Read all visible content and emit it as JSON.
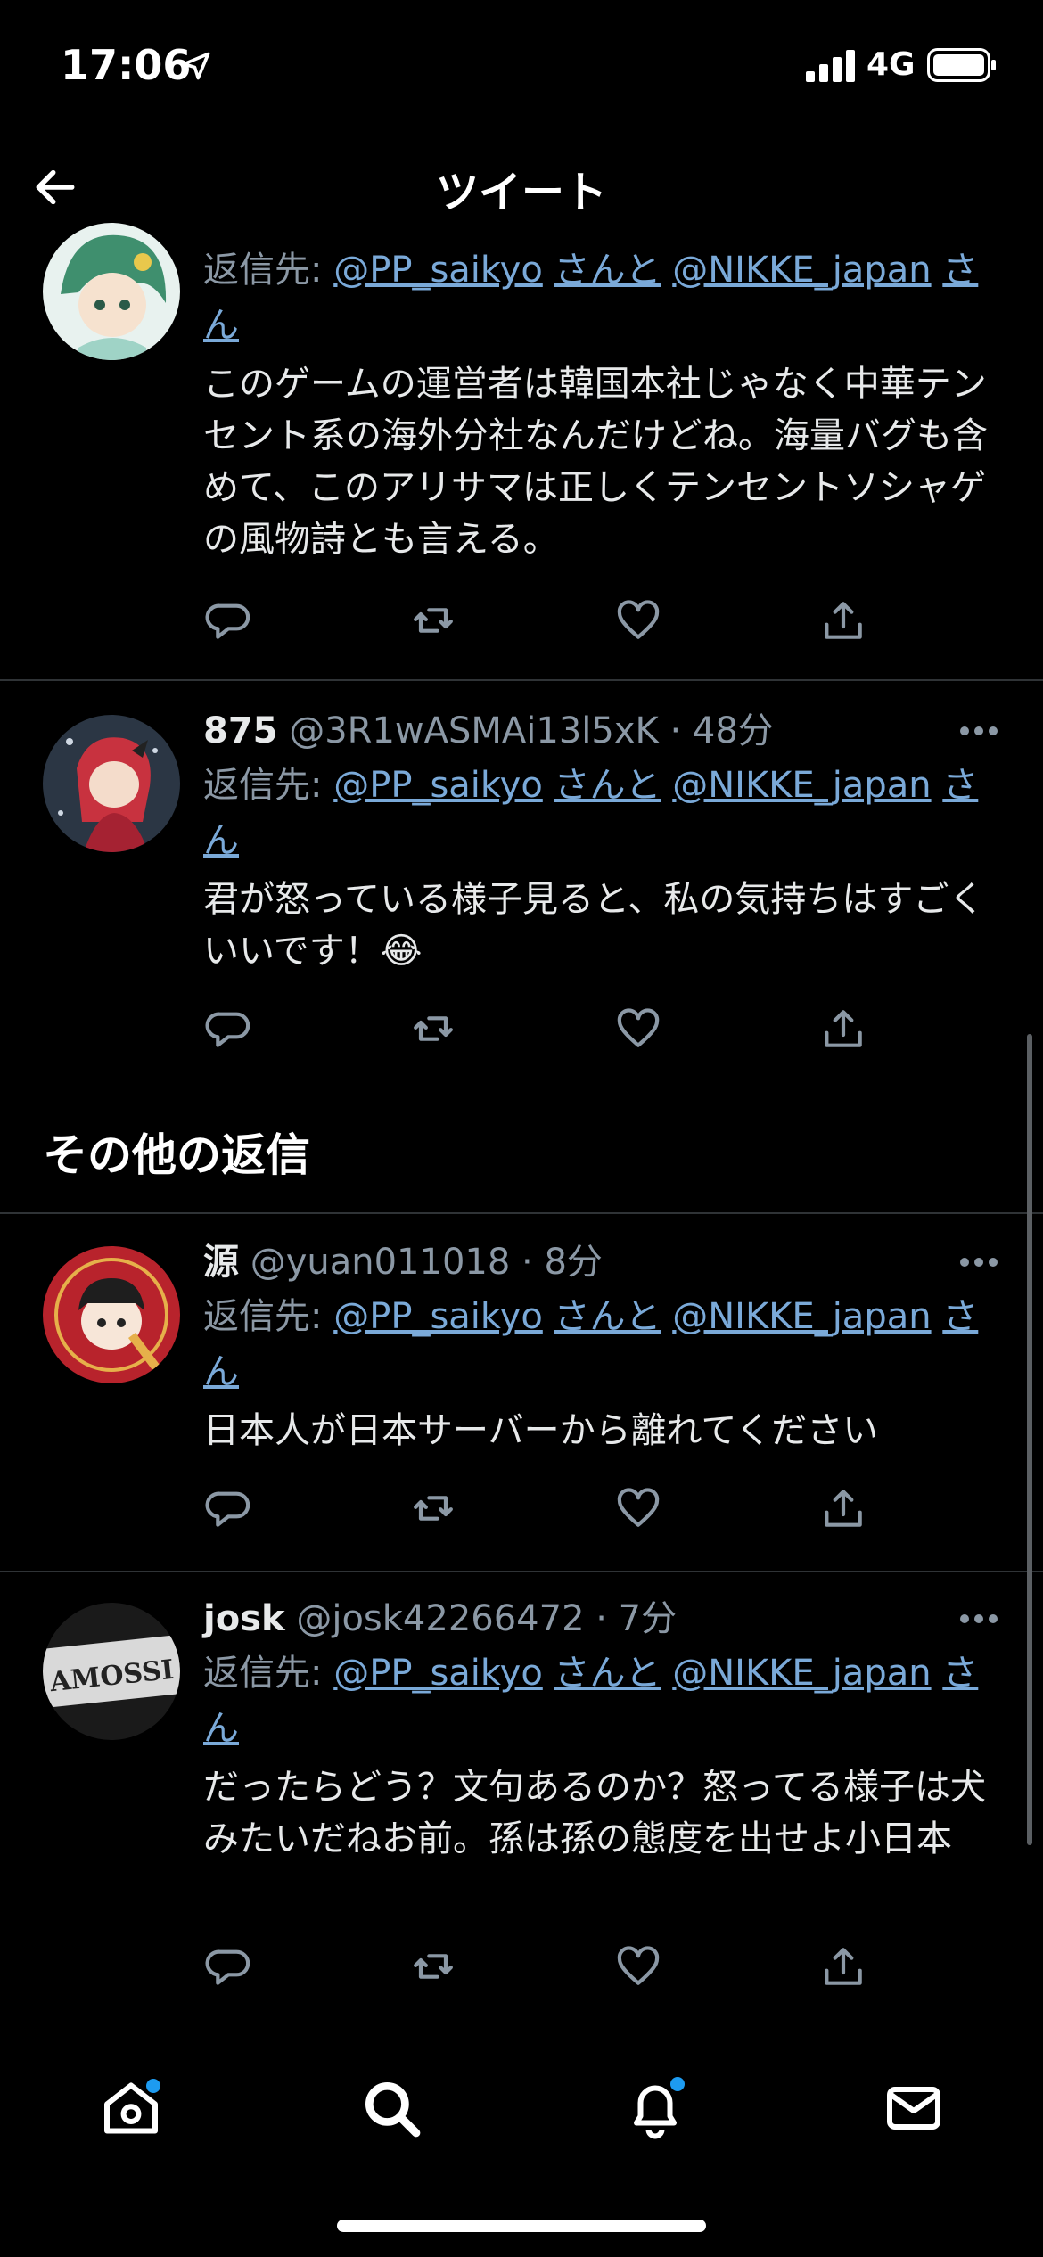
{
  "status_bar": {
    "time": "17:06",
    "network": "4G"
  },
  "header": {
    "title": "ツイート"
  },
  "reply_prefix": "返信先:",
  "tweets": [
    {
      "name": "",
      "handle": "",
      "time": "",
      "reply_to_a": "@PP_saikyo",
      "reply_mid": "さんと",
      "reply_to_b": "@NIKKE_japan",
      "reply_end_1": "さ",
      "reply_end_2": "ん",
      "text": "このゲームの運営者は韓国本社じゃなく中華テンセント系の海外分社なんだけどね。海量バグも含めて、このアリサマは正しくテンセントソシャゲの風物詩とも言える。"
    },
    {
      "name": "875",
      "handle": "@3R1wASMAi13l5xK",
      "dot": "·",
      "time": "48分",
      "reply_to_a": "@PP_saikyo",
      "reply_mid": "さんと",
      "reply_to_b": "@NIKKE_japan",
      "reply_end_1": "さ",
      "reply_end_2": "ん",
      "text": "君が怒っている様子見ると、私の気持ちはすごくいいです！😂"
    },
    {
      "name": "源",
      "handle": "@yuan011018",
      "dot": "·",
      "time": "8分",
      "reply_to_a": "@PP_saikyo",
      "reply_mid": "さんと",
      "reply_to_b": "@NIKKE_japan",
      "reply_end_1": "さ",
      "reply_end_2": "ん",
      "text": "日本人が日本サーバーから離れてください"
    },
    {
      "name": "josk",
      "handle": "@josk42266472",
      "dot": "·",
      "time": "7分",
      "reply_to_a": "@PP_saikyo",
      "reply_mid": "さんと",
      "reply_to_b": "@NIKKE_japan",
      "reply_end_1": "さ",
      "reply_end_2": "ん",
      "text": "だったらどう？文句あるのか？怒ってる様子は犬みたいだねお前。孫は孫の態度を出せよ小日本"
    }
  ],
  "section": {
    "other_replies": "その他の返信"
  },
  "avatar_text": {
    "josk": "AMOSSI"
  },
  "nav": {
    "items": [
      "home-icon",
      "search-icon",
      "notifications-icon",
      "messages-icon"
    ]
  },
  "colors": {
    "accent": "#1d9bf0",
    "link": "#7aa9d8",
    "muted": "#8b98a5"
  }
}
